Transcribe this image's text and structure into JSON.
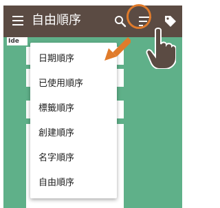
{
  "app_bar": {
    "title": "自由順序",
    "icons": [
      "menu-icon",
      "search-icon",
      "sort-icon",
      "tag-icon"
    ]
  },
  "tab": {
    "label": "Ide"
  },
  "sort_menu": {
    "items": [
      {
        "label": "日期順序"
      },
      {
        "label": "已使用順序"
      },
      {
        "label": "標籤順序"
      },
      {
        "label": "創建順序"
      },
      {
        "label": "名字順序"
      },
      {
        "label": "自由順序"
      }
    ]
  },
  "colors": {
    "app_bar": "#5b4b43",
    "background": "#5fb089",
    "highlight": "#e07b2b"
  }
}
